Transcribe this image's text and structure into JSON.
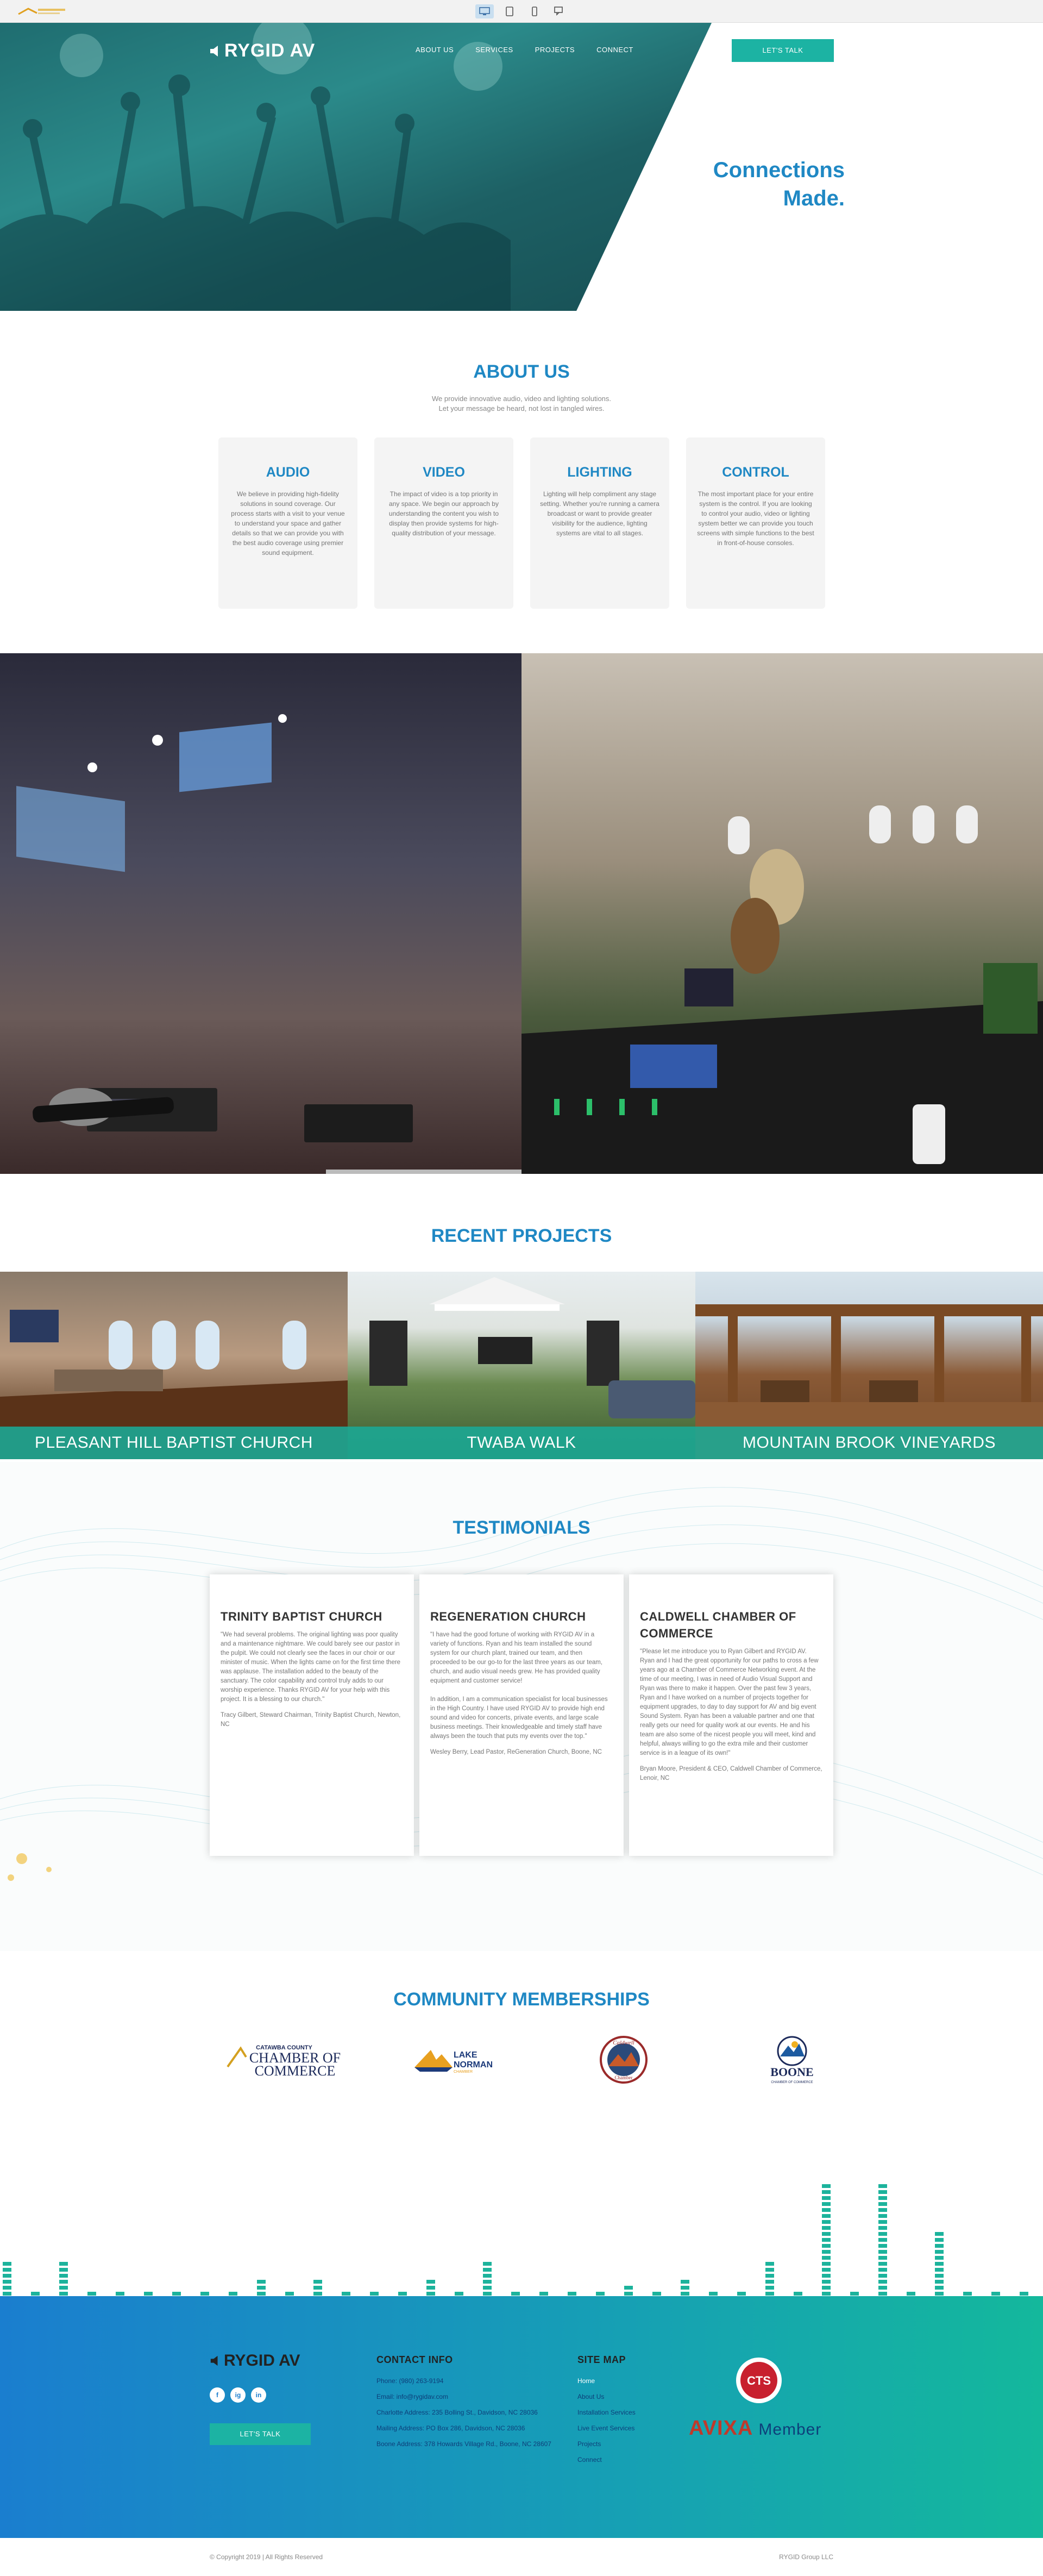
{
  "colors": {
    "brand": "#1f88c4",
    "accent": "#1cb3a3",
    "teal": "#14b89c",
    "footer_start": "#1a7ecf"
  },
  "header": {
    "logo_text": "RYGID AV",
    "nav": [
      "ABOUT US",
      "SERVICES",
      "PROJECTS",
      "CONNECT"
    ],
    "cta": "LET'S TALK",
    "tagline_line1": "Connections",
    "tagline_line2": "Made."
  },
  "about": {
    "title": "ABOUT US",
    "sub_line1": "We provide innovative audio, video and lighting solutions.",
    "sub_line2": "Let your message be heard, not lost in tangled wires.",
    "cards": [
      {
        "title": "AUDIO",
        "text": "We believe in providing high-fidelity solutions in sound coverage. Our process starts with a visit to your venue to understand your space and gather details so that we can provide you with the best audio coverage using premier sound equipment."
      },
      {
        "title": "VIDEO",
        "text": "The impact of video is a top priority in any space. We begin our approach by understanding the content you wish to display then provide systems for high-quality distribution of your message."
      },
      {
        "title": "LIGHTING",
        "text": "Lighting will help compliment any stage setting. Whether you're running a camera broadcast or want to provide greater visibility for the audience, lighting systems are vital to all stages."
      },
      {
        "title": "CONTROL",
        "text": "The most important place for your entire system is the control. If you are looking to control your audio, video or lighting system better we can provide you touch screens with simple functions to the best in front-of-house consoles."
      }
    ]
  },
  "projects": {
    "title": "RECENT PROJECTS",
    "items": [
      "PLEASANT HILL BAPTIST CHURCH",
      "TWABA WALK",
      "MOUNTAIN BROOK VINEYARDS"
    ]
  },
  "testimonials": {
    "title": "TESTIMONIALS",
    "items": [
      {
        "org": "TRINITY BAPTIST CHURCH",
        "quote": "\"We had several problems. The original lighting was poor quality and a maintenance nightmare. We could barely see our pastor in the pulpit. We could not clearly see the faces in our choir or our minister of music. When the lights came on for the first time there was applause. The installation added to the beauty of the sanctuary. The color capability and control truly adds to our worship experience. Thanks RYGID AV for your help with this project. It is a blessing to our church.\"",
        "author": "Tracy Gilbert, Steward Chairman, Trinity Baptist Church, Newton, NC"
      },
      {
        "org": "REGENERATION CHURCH",
        "quote": "\"I have had the good fortune of working with RYGID AV in a variety of functions. Ryan and his team installed the sound system for our church plant, trained our team, and then proceeded to be our go-to for the last three years as our team, church, and audio visual needs grew. He has provided quality equipment and customer service!\n\nIn addition, I am a communication specialist for local businesses in the High Country. I have used RYGID AV to provide high end sound and video for concerts, private events, and large scale business meetings. Their knowledgeable and timely staff have always been the touch that puts my events over the top.\"",
        "author": "Wesley Berry, Lead Pastor, ReGeneration Church, Boone, NC"
      },
      {
        "org": "CALDWELL CHAMBER OF COMMERCE",
        "quote": "\"Please let me introduce you to Ryan Gilbert and RYGID AV. Ryan and I had the great opportunity for our paths to cross a few years ago at a Chamber of Commerce Networking event. At the time of our meeting, I was in need of Audio Visual Support and Ryan was there to make it happen. Over the past few 3 years, Ryan and I have worked on a number of projects together for equipment upgrades, to day to day support for AV and big event Sound System. Ryan has been a valuable partner and one that really gets our need for quality work at our events. He and his team are also some of the nicest people you will meet, kind and helpful, always willing to go the extra mile and their customer service is in a league of its own!\"",
        "author": "Bryan Moore, President & CEO, Caldwell Chamber of Commerce, Lenoir, NC"
      }
    ]
  },
  "memberships": {
    "title": "COMMUNITY MEMBERSHIPS",
    "items": [
      {
        "line1": "CATAWBA COUNTY",
        "line2": "CHAMBER OF",
        "line3": "COMMERCE"
      },
      {
        "line1": "LAKE",
        "line2": "NORMAN",
        "line3": "CHAMBER"
      },
      {
        "line1": "Caldwell",
        "line2": "Chamber",
        "line3": ""
      },
      {
        "line1": "BOONE",
        "line2": "CHAMBER OF COMMERCE",
        "line3": ""
      }
    ]
  },
  "footer": {
    "logo_text": "RYGID AV",
    "social": [
      "f",
      "ig",
      "in"
    ],
    "cta": "LET'S TALK",
    "contact_title": "CONTACT INFO",
    "contact": [
      "Phone: (980) 263-9194",
      "Email: info@rygidav.com",
      "Charlotte Address: 235 Bolling St., Davidson, NC 28036",
      "Mailing Address: PO Box 286, Davidson, NC 28036",
      "Boone Address: 378 Howards Village Rd., Boone, NC 28607"
    ],
    "sitemap_title": "SITE MAP",
    "sitemap": [
      "Home",
      "About Us",
      "Installation Services",
      "Live Event Services",
      "Projects",
      "Connect"
    ],
    "cts": "CTS",
    "avixa": "AVIXA",
    "avixa_member": "Member",
    "copyright": "© Copyright 2019 | All Rights Reserved",
    "company": "RYGID Group LLC"
  }
}
